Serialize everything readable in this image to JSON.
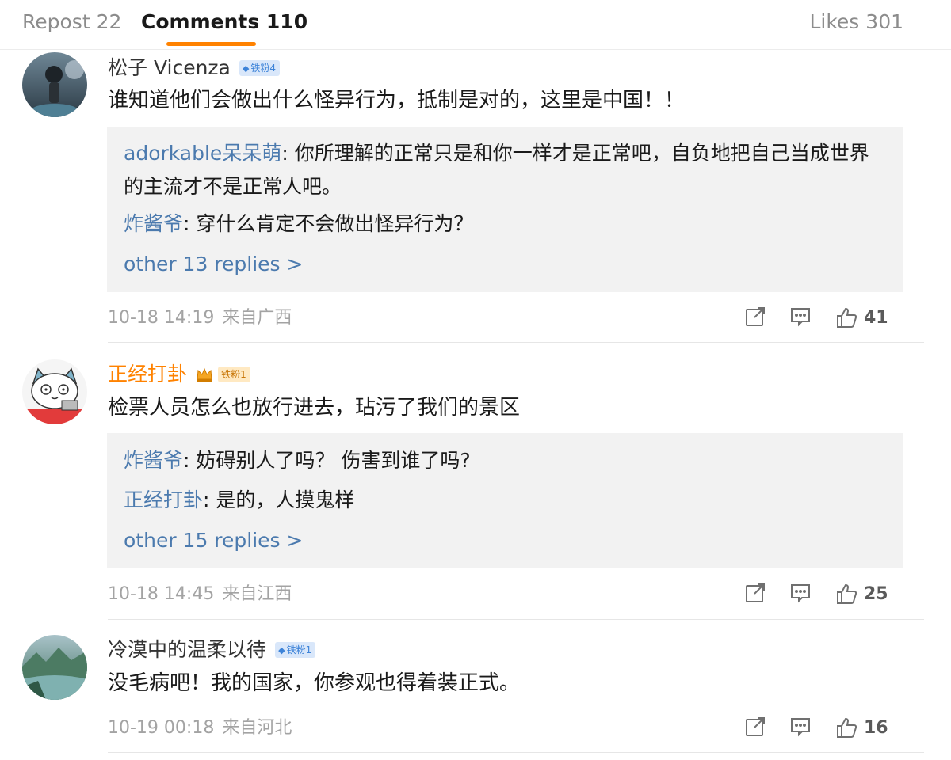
{
  "tabs": {
    "repost": "Repost 22",
    "comments": "Comments 110",
    "likes": "Likes 301"
  },
  "comments": [
    {
      "username": "松子 Vicenza",
      "badge": "铁粉4",
      "text": "谁知道他们会做出什么怪异行为，抵制是对的，这里是中国！！",
      "replies": [
        {
          "name": "adorkable呆呆萌",
          "text": ": 你所理解的正常只是和你一样才是正常吧，自负地把自己当成世界的主流才不是正常人吧。"
        },
        {
          "name": "炸酱爷",
          "text": ": 穿什么肯定不会做出怪异行为？"
        }
      ],
      "more": "other 13 replies >",
      "time": "10-18 14:19",
      "location": "来自广西",
      "likes": "41"
    },
    {
      "username": "正经打卦",
      "badge": "铁粉1",
      "text": "检票人员怎么也放行进去，玷污了我们的景区",
      "replies": [
        {
          "name": "炸酱爷",
          "text": ": 妨碍别人了吗？ 伤害到谁了吗?"
        },
        {
          "name": "正经打卦",
          "text": ": 是的，人摸鬼样"
        }
      ],
      "more": "other 15 replies >",
      "time": "10-18 14:45",
      "location": "来自江西",
      "likes": "25"
    },
    {
      "username": "冷漠中的温柔以待",
      "badge": "铁粉1",
      "text": "没毛病吧！我的国家，你参观也得着装正式。",
      "time": "10-19 00:18",
      "location": "来自河北",
      "likes": "16"
    }
  ],
  "icons": {
    "share": "share-icon",
    "comment": "comment-icon",
    "like": "thumbs-up-icon"
  },
  "colors": {
    "accent": "#ff8200",
    "link": "#4b7aae",
    "badge_blue": "#3d83d8"
  }
}
